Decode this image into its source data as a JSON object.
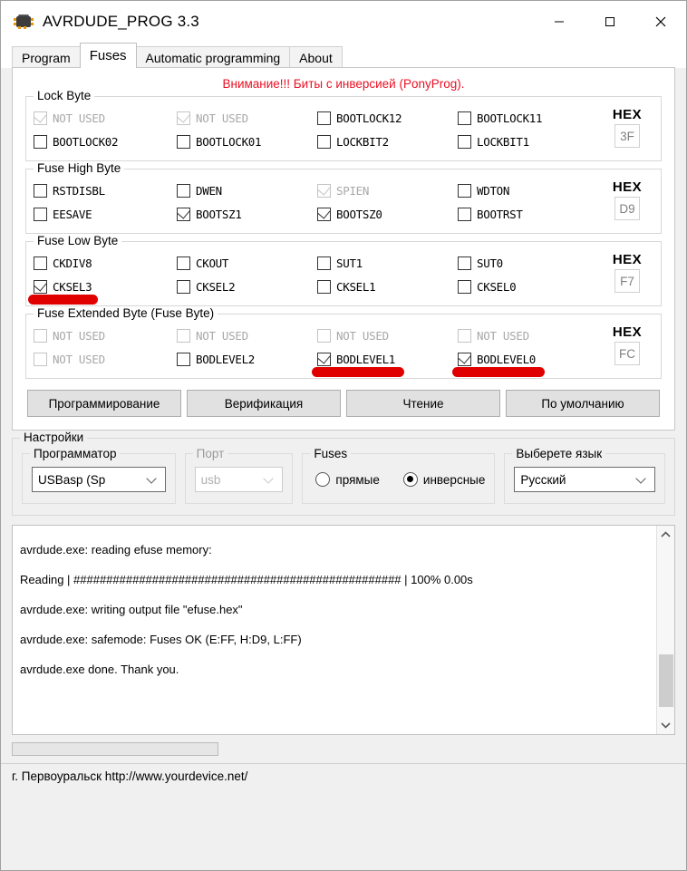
{
  "window": {
    "title": "AVRDUDE_PROG 3.3",
    "icon": "microchip-icon",
    "controls": {
      "minimize": "—",
      "maximize": "□",
      "close": "✕"
    }
  },
  "tabs": [
    {
      "label": "Program",
      "active": false
    },
    {
      "label": "Fuses",
      "active": true
    },
    {
      "label": "Automatic programming",
      "active": false
    },
    {
      "label": "About",
      "active": false
    }
  ],
  "fuses_page": {
    "warning": "Внимание!!! Биты с инверсией (PonyProg).",
    "warning_color": "#e81123",
    "hex_label": "HEX",
    "groups": [
      {
        "title": "Lock Byte",
        "hex": "3F",
        "bits": [
          {
            "label": "NOT USED",
            "checked": true,
            "enabled": false,
            "marked": false
          },
          {
            "label": "NOT USED",
            "checked": true,
            "enabled": false,
            "marked": false
          },
          {
            "label": "BOOTLOCK12",
            "checked": false,
            "enabled": true,
            "marked": false
          },
          {
            "label": "BOOTLOCK11",
            "checked": false,
            "enabled": true,
            "marked": false
          },
          {
            "label": "BOOTLOCK02",
            "checked": false,
            "enabled": true,
            "marked": false
          },
          {
            "label": "BOOTLOCK01",
            "checked": false,
            "enabled": true,
            "marked": false
          },
          {
            "label": "LOCKBIT2",
            "checked": false,
            "enabled": true,
            "marked": false
          },
          {
            "label": "LOCKBIT1",
            "checked": false,
            "enabled": true,
            "marked": false
          }
        ]
      },
      {
        "title": "Fuse High Byte",
        "hex": "D9",
        "bits": [
          {
            "label": "RSTDISBL",
            "checked": false,
            "enabled": true,
            "marked": false
          },
          {
            "label": "DWEN",
            "checked": false,
            "enabled": true,
            "marked": false
          },
          {
            "label": "SPIEN",
            "checked": true,
            "enabled": false,
            "marked": false
          },
          {
            "label": "WDTON",
            "checked": false,
            "enabled": true,
            "marked": false
          },
          {
            "label": "EESAVE",
            "checked": false,
            "enabled": true,
            "marked": false
          },
          {
            "label": "BOOTSZ1",
            "checked": true,
            "enabled": true,
            "marked": false
          },
          {
            "label": "BOOTSZ0",
            "checked": true,
            "enabled": true,
            "marked": false
          },
          {
            "label": "BOOTRST",
            "checked": false,
            "enabled": true,
            "marked": false
          }
        ]
      },
      {
        "title": "Fuse Low Byte",
        "hex": "F7",
        "bits": [
          {
            "label": "CKDIV8",
            "checked": false,
            "enabled": true,
            "marked": false
          },
          {
            "label": "CKOUT",
            "checked": false,
            "enabled": true,
            "marked": false
          },
          {
            "label": "SUT1",
            "checked": false,
            "enabled": true,
            "marked": false
          },
          {
            "label": "SUT0",
            "checked": false,
            "enabled": true,
            "marked": false
          },
          {
            "label": "CKSEL3",
            "checked": true,
            "enabled": true,
            "marked": true
          },
          {
            "label": "CKSEL2",
            "checked": false,
            "enabled": true,
            "marked": false
          },
          {
            "label": "CKSEL1",
            "checked": false,
            "enabled": true,
            "marked": false
          },
          {
            "label": "CKSEL0",
            "checked": false,
            "enabled": true,
            "marked": false
          }
        ]
      },
      {
        "title": "Fuse Extended Byte (Fuse Byte)",
        "hex": "FC",
        "bits": [
          {
            "label": "NOT USED",
            "checked": false,
            "enabled": false,
            "marked": false
          },
          {
            "label": "NOT USED",
            "checked": false,
            "enabled": false,
            "marked": false
          },
          {
            "label": "NOT USED",
            "checked": false,
            "enabled": false,
            "marked": false
          },
          {
            "label": "NOT USED",
            "checked": false,
            "enabled": false,
            "marked": false
          },
          {
            "label": "NOT USED",
            "checked": false,
            "enabled": false,
            "marked": false
          },
          {
            "label": "BODLEVEL2",
            "checked": false,
            "enabled": true,
            "marked": false
          },
          {
            "label": "BODLEVEL1",
            "checked": true,
            "enabled": true,
            "marked": true
          },
          {
            "label": "BODLEVEL0",
            "checked": true,
            "enabled": true,
            "marked": true
          }
        ]
      }
    ],
    "buttons": [
      {
        "label": "Программирование"
      },
      {
        "label": "Верификация"
      },
      {
        "label": "Чтение"
      },
      {
        "label": "По умолчанию"
      }
    ]
  },
  "settings": {
    "title": "Настройки",
    "programmer": {
      "label": "Программатор",
      "value": "USBasp (Sp"
    },
    "port": {
      "label": "Порт",
      "value": "usb"
    },
    "fuses": {
      "label": "Fuses",
      "options": [
        {
          "label": "прямые",
          "selected": false
        },
        {
          "label": "инверсные",
          "selected": true
        }
      ]
    },
    "language": {
      "label": "Выберете язык",
      "value": "Русский"
    }
  },
  "log": {
    "lines": [
      "avrdude.exe: reading efuse memory:",
      "Reading | ################################################## | 100% 0.00s",
      "avrdude.exe: writing output file \"efuse.hex\"",
      "avrdude.exe: safemode: Fuses OK (E:FF, H:D9, L:FF)",
      "avrdude.exe done.  Thank you."
    ],
    "scroll_up_icon": "chevron-up-icon",
    "scroll_down_icon": "chevron-down-icon"
  },
  "statusbar": {
    "text": "г. Первоуральск   http://www.yourdevice.net/"
  }
}
